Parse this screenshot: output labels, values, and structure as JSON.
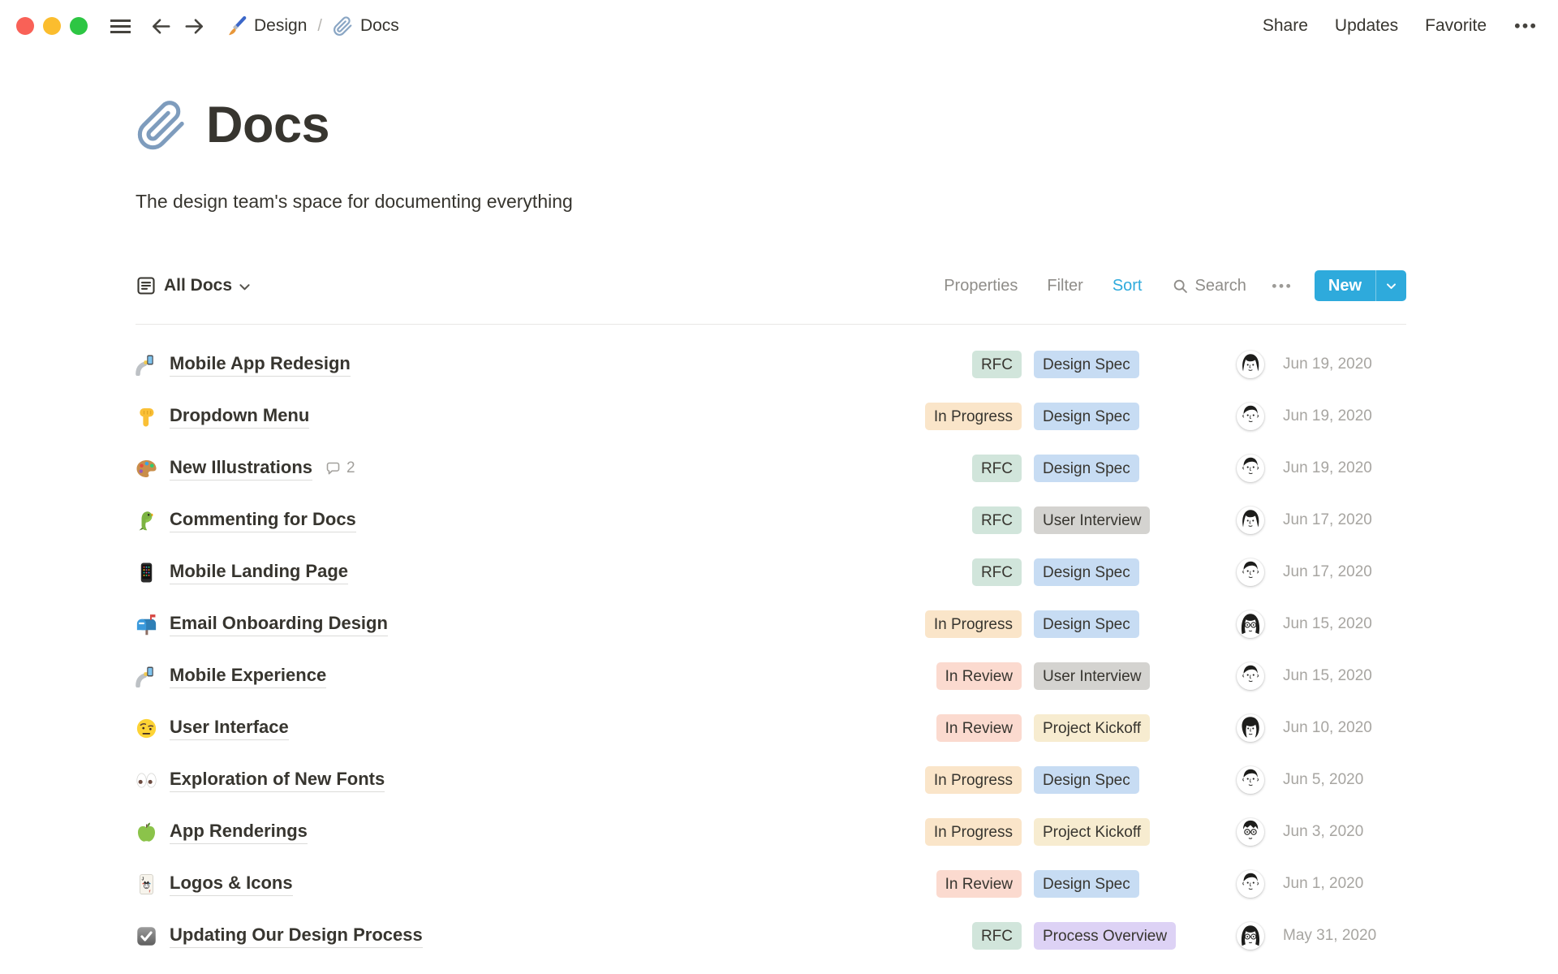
{
  "window": {
    "traffic_lights": [
      "#f96157",
      "#fbbd2e",
      "#2dc643"
    ],
    "breadcrumb": [
      {
        "icon": "paintbrush-icon",
        "label": "Design"
      },
      {
        "icon": "paperclip-icon",
        "label": "Docs"
      }
    ],
    "breadcrumb_separator": "/",
    "actions": [
      "Share",
      "Updates",
      "Favorite"
    ]
  },
  "page": {
    "icon": "paperclip-icon",
    "title": "Docs",
    "subtitle": "The design team's space for documenting everything"
  },
  "toolbar": {
    "view": {
      "icon": "table-view-icon",
      "label": "All Docs"
    },
    "properties_label": "Properties",
    "filter_label": "Filter",
    "sort_label": "Sort",
    "search_label": "Search",
    "new_label": "New",
    "accent_color": "#2eaadc"
  },
  "tag_colors": {
    "RFC": "#d1e5db",
    "In Progress": "#fae5c9",
    "In Review": "#fbdacf",
    "Design Spec": "#c7dcf3",
    "User Interview": "#d4d3d0",
    "Project Kickoff": "#f7ecd0",
    "Process Overview": "#ddd2f5"
  },
  "docs": [
    {
      "icon": "selfie-icon",
      "name": "Mobile App Redesign",
      "status": "RFC",
      "type": "Design Spec",
      "avatar": "avatar-woman-bob",
      "date": "Jun 19, 2020"
    },
    {
      "icon": "pointing-down-icon",
      "name": "Dropdown Menu",
      "status": "In Progress",
      "type": "Design Spec",
      "avatar": "avatar-man",
      "date": "Jun 19, 2020"
    },
    {
      "icon": "palette-icon",
      "name": "New Illustrations",
      "comments": 2,
      "status": "RFC",
      "type": "Design Spec",
      "avatar": "avatar-man",
      "date": "Jun 19, 2020"
    },
    {
      "icon": "parrot-icon",
      "name": "Commenting for Docs",
      "status": "RFC",
      "type": "User Interview",
      "avatar": "avatar-woman-bob",
      "date": "Jun 17, 2020"
    },
    {
      "icon": "mobile-phone-icon",
      "name": "Mobile Landing Page",
      "status": "RFC",
      "type": "Design Spec",
      "avatar": "avatar-man",
      "date": "Jun 17, 2020"
    },
    {
      "icon": "mailbox-icon",
      "name": "Email Onboarding Design",
      "status": "In Progress",
      "type": "Design Spec",
      "avatar": "avatar-glasses-long",
      "date": "Jun 15, 2020"
    },
    {
      "icon": "selfie-icon",
      "name": "Mobile Experience",
      "status": "In Review",
      "type": "User Interview",
      "avatar": "avatar-man",
      "date": "Jun 15, 2020"
    },
    {
      "icon": "face-raised-eyebrow-icon",
      "name": "User Interface",
      "status": "In Review",
      "type": "Project Kickoff",
      "avatar": "avatar-woman-curly",
      "date": "Jun 10, 2020"
    },
    {
      "icon": "eyes-icon",
      "name": "Exploration of New Fonts",
      "status": "In Progress",
      "type": "Design Spec",
      "avatar": "avatar-man",
      "date": "Jun 5, 2020"
    },
    {
      "icon": "green-apple-icon",
      "name": "App Renderings",
      "status": "In Progress",
      "type": "Project Kickoff",
      "avatar": "avatar-man-glasses",
      "date": "Jun 3, 2020"
    },
    {
      "icon": "joker-card-icon",
      "name": "Logos & Icons",
      "status": "In Review",
      "type": "Design Spec",
      "avatar": "avatar-man",
      "date": "Jun 1, 2020"
    },
    {
      "icon": "checked-checkbox-icon",
      "name": "Updating Our Design Process",
      "status": "RFC",
      "type": "Process Overview",
      "avatar": "avatar-glasses-long",
      "date": "May 31, 2020"
    }
  ]
}
